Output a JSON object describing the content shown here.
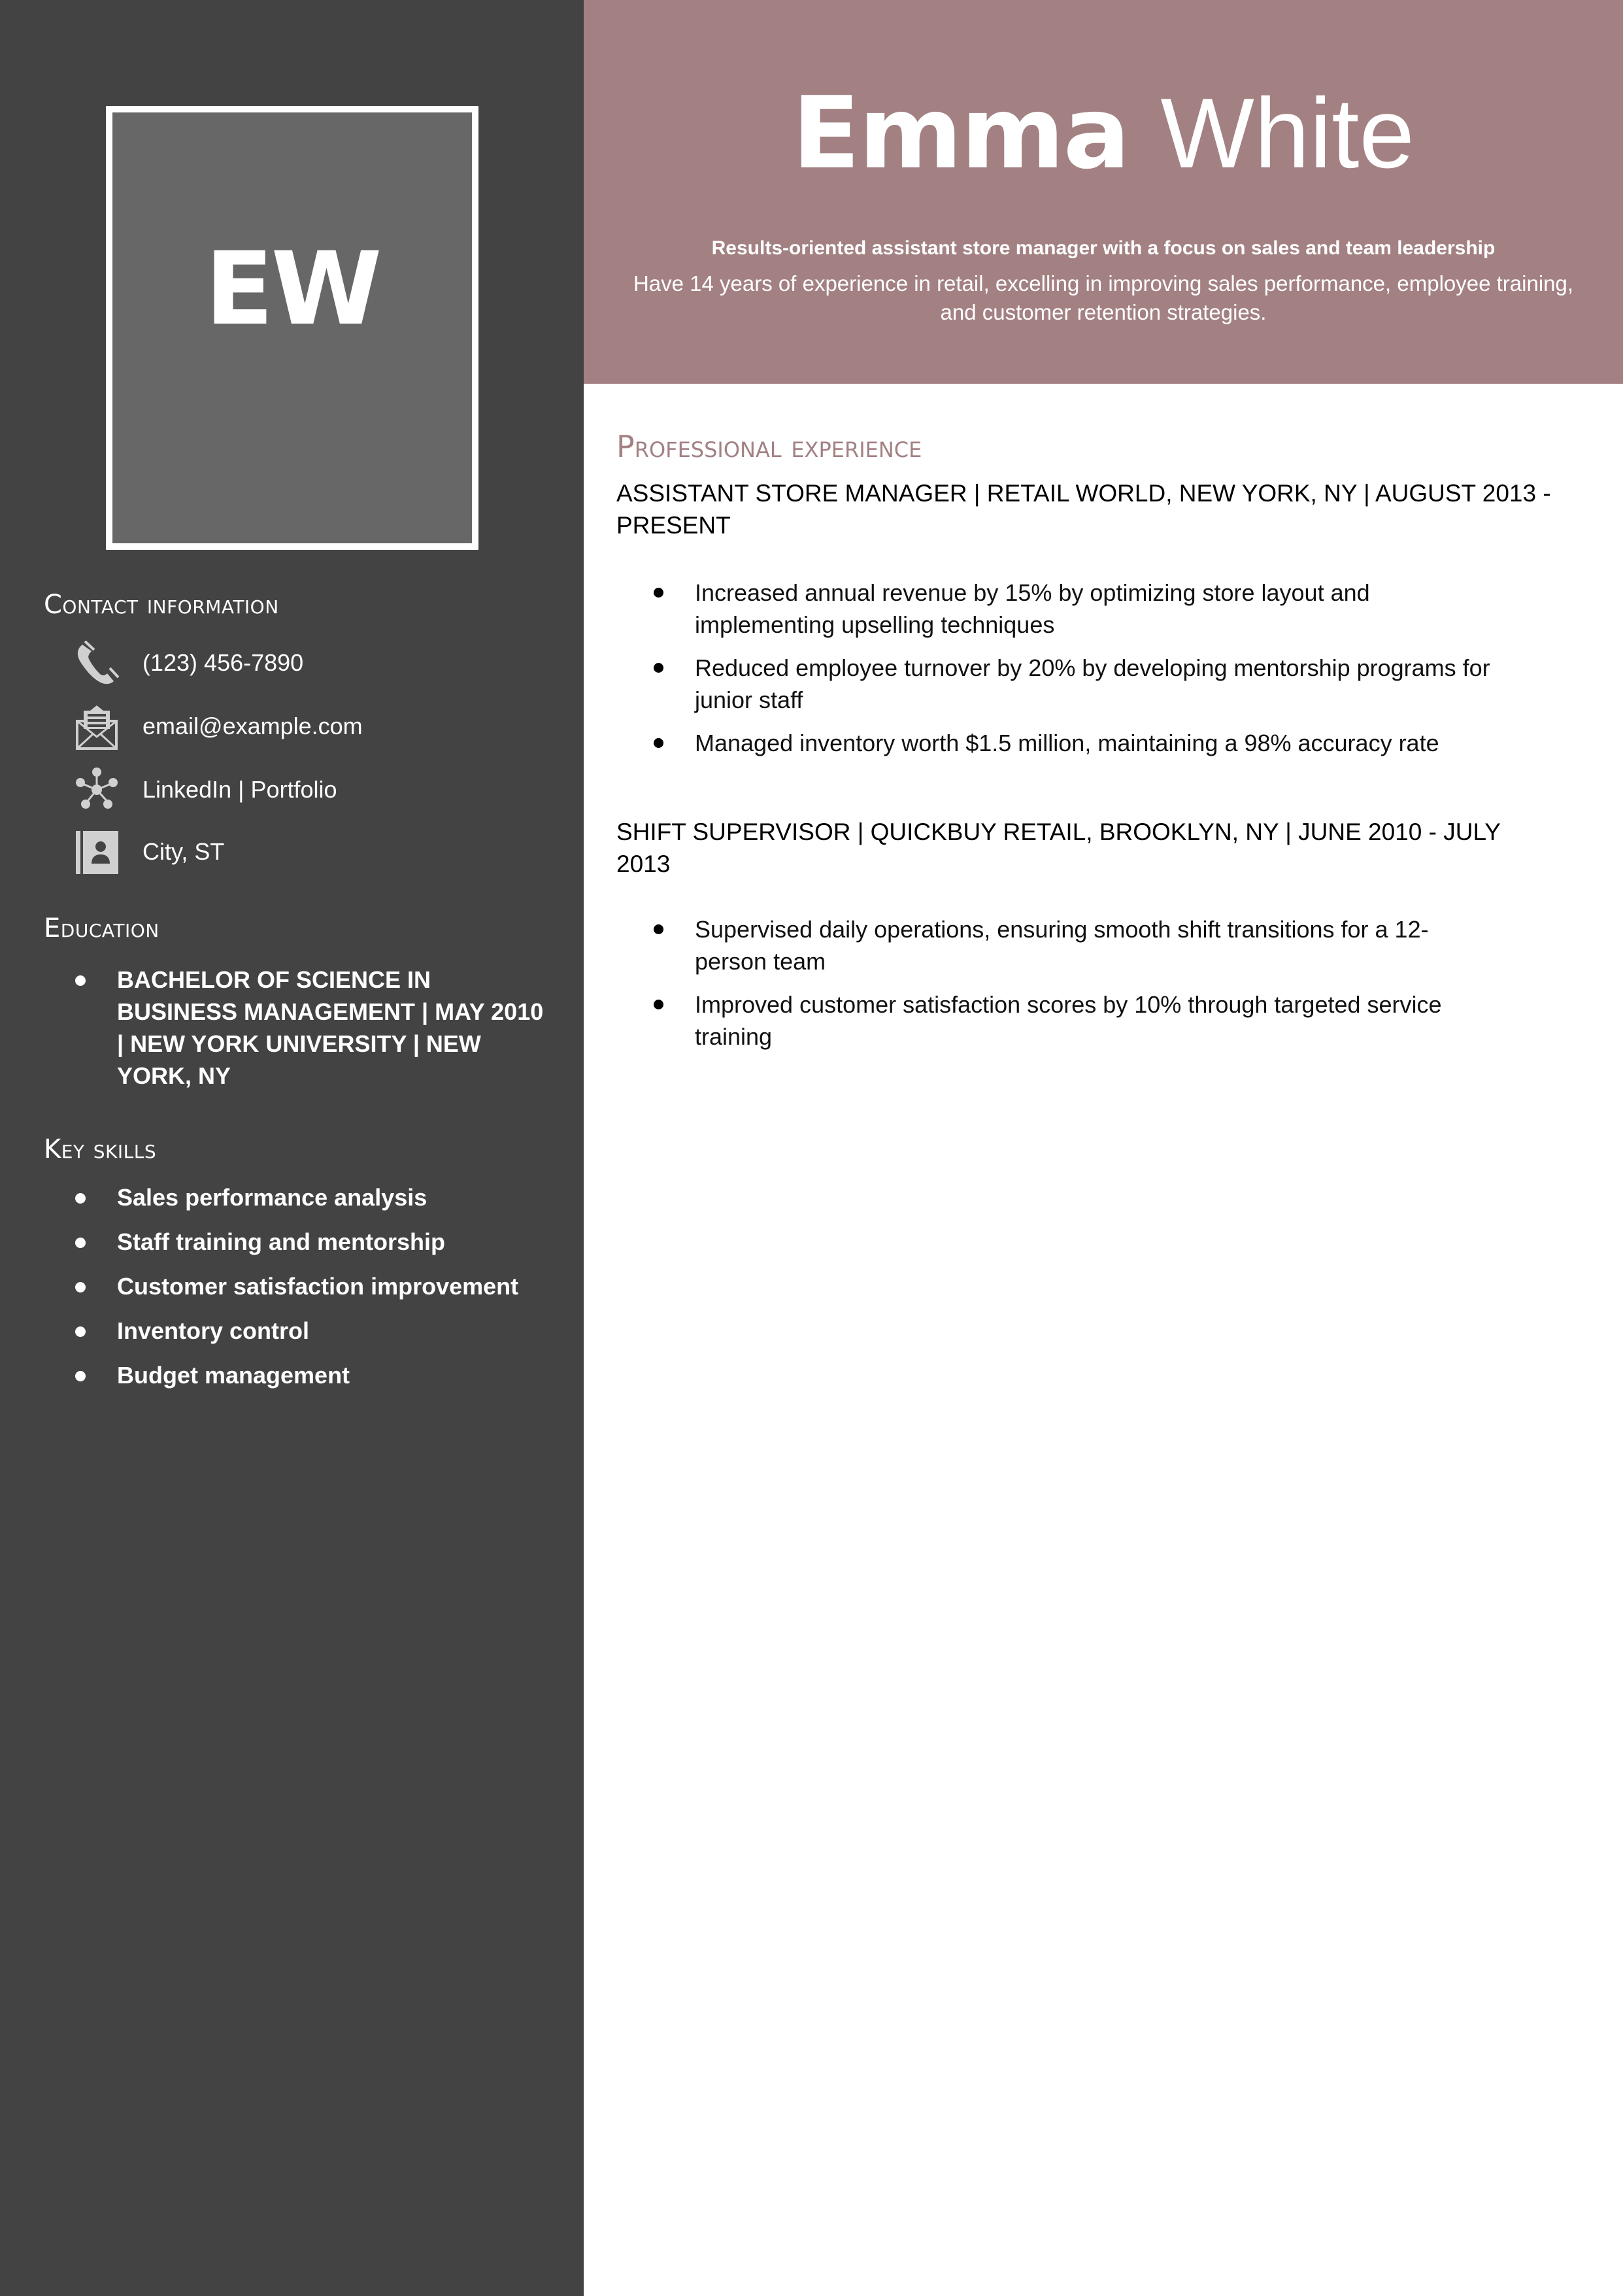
{
  "sidebar": {
    "initials": "EW",
    "contact": {
      "heading": "Contact information",
      "items": [
        {
          "icon": "phone-icon",
          "text": "(123) 456-7890"
        },
        {
          "icon": "email-icon",
          "text": "email@example.com"
        },
        {
          "icon": "network-icon",
          "text": "LinkedIn | Portfolio"
        },
        {
          "icon": "contact-card-icon",
          "text": "City, ST"
        }
      ]
    },
    "education": {
      "heading": "Education",
      "items": [
        "BACHELOR OF SCIENCE IN BUSINESS MANAGEMENT | MAY 2010 | NEW YORK UNIVERSITY | NEW YORK, NY"
      ]
    },
    "skills": {
      "heading": "Key skills",
      "items": [
        "Sales performance analysis",
        "Staff training and mentorship",
        "Customer satisfaction improvement",
        "Inventory control",
        "Budget management"
      ]
    }
  },
  "header": {
    "first_name": "Emma",
    "last_name": "White",
    "tagline": "Results-oriented assistant store manager with a focus on sales and team leadership",
    "summary": "Have 14 years of experience in retail, excelling in improving sales performance, employee training, and customer retention strategies."
  },
  "experience": {
    "heading": "Professional experience",
    "jobs": [
      {
        "title": "ASSISTANT STORE MANAGER | RETAIL WORLD, NEW YORK, NY | AUGUST 2013 - PRESENT",
        "bullets": [
          "Increased annual revenue by 15% by optimizing store layout and implementing upselling techniques",
          "Reduced employee turnover by 20% by developing mentorship programs for junior staff",
          "Managed inventory worth $1.5 million, maintaining a 98% accuracy rate"
        ]
      },
      {
        "title": "SHIFT SUPERVISOR | QUICKBUY RETAIL, BROOKLYN, NY | JUNE 2010 - JULY 2013",
        "bullets": [
          "Supervised daily operations, ensuring smooth shift transitions for a 12-person team",
          "Improved customer satisfaction scores by 10% through targeted service training"
        ]
      }
    ]
  },
  "colors": {
    "sidebar": "#434343",
    "accent": "#a38183",
    "photo_box": "#676767",
    "icon": "#d0d0d0"
  }
}
